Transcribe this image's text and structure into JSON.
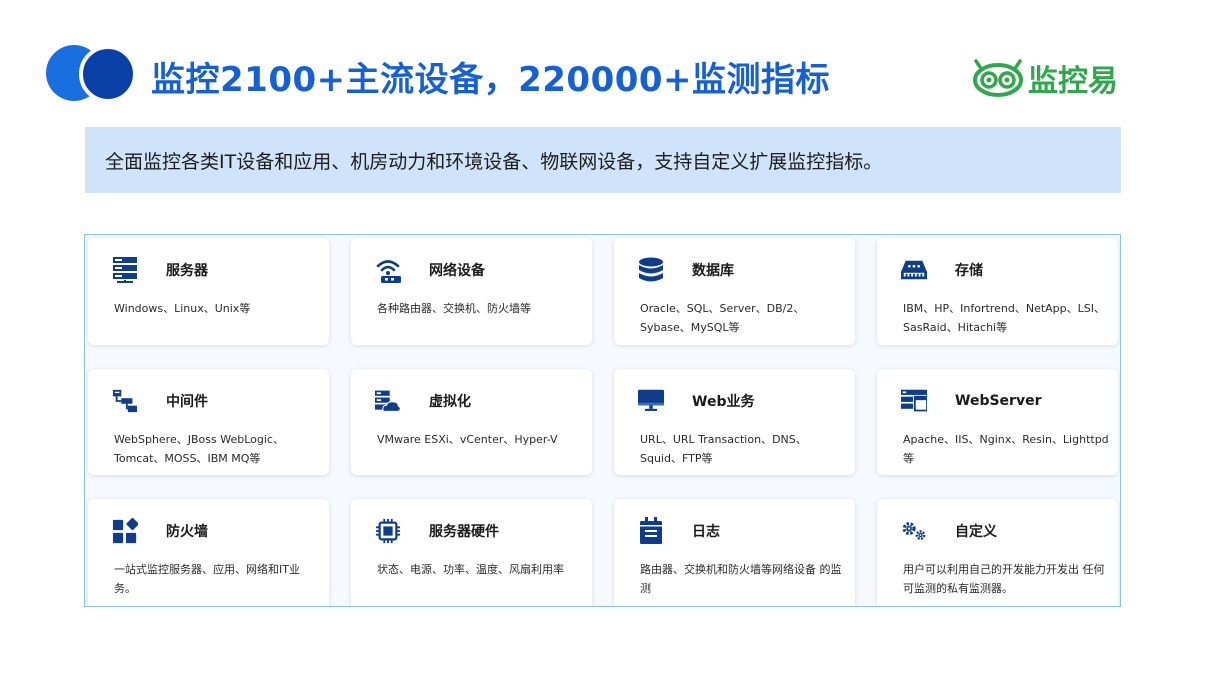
{
  "header": {
    "title": "监控2100+主流设备，220000+监测指标",
    "brand": "监控易"
  },
  "banner": {
    "text": "全面监控各类IT设备和应用、机房动力和环境设备、物联网设备，支持自定义扩展监控指标。"
  },
  "colors": {
    "title_blue": "#1560d4",
    "icon_navy": "#0f3d8c",
    "banner_bg": "#cfe3fa",
    "brand_green": "#2ea84a"
  },
  "cards": [
    {
      "icon": "server-icon",
      "title": "服务器",
      "desc": "Windows、Linux、Unix等"
    },
    {
      "icon": "wifi-router-icon",
      "title": "网络设备",
      "desc": "各种路由器、交换机、防火墙等"
    },
    {
      "icon": "database-icon",
      "title": "数据库",
      "desc": "Oracle、SQL、Server、DB/2、Sybase、MySQL等"
    },
    {
      "icon": "storage-icon",
      "title": "存储",
      "desc": "IBM、HP、Infortrend、NetApp、LSI、SasRaid、Hitachi等"
    },
    {
      "icon": "middleware-icon",
      "title": "中间件",
      "desc": "WebSphere、JBoss WebLogic、Tomcat、MOSS、IBM MQ等"
    },
    {
      "icon": "cloud-server-icon",
      "title": "虚拟化",
      "desc": "VMware ESXi、vCenter、Hyper-V"
    },
    {
      "icon": "monitor-icon",
      "title": "Web业务",
      "desc": "URL、URL Transaction、DNS、Squid、FTP等"
    },
    {
      "icon": "browser-window-icon",
      "title": "WebServer",
      "desc": "Apache、IIS、Nginx、Resin、Lighttpd等"
    },
    {
      "icon": "apps-grid-icon",
      "title": "防火墙",
      "desc": "一站式监控服务器、应用、网络和IT业务。"
    },
    {
      "icon": "chip-icon",
      "title": "服务器硬件",
      "desc": "状态、电源、功率、温度、风扇利用率"
    },
    {
      "icon": "calendar-log-icon",
      "title": "日志",
      "desc": "路由器、交换机和防火墙等网络设备 的监测"
    },
    {
      "icon": "gears-icon",
      "title": "自定义",
      "desc": "用户可以利用自己的开发能力开发出 任何可监测的私有监测器。"
    }
  ]
}
